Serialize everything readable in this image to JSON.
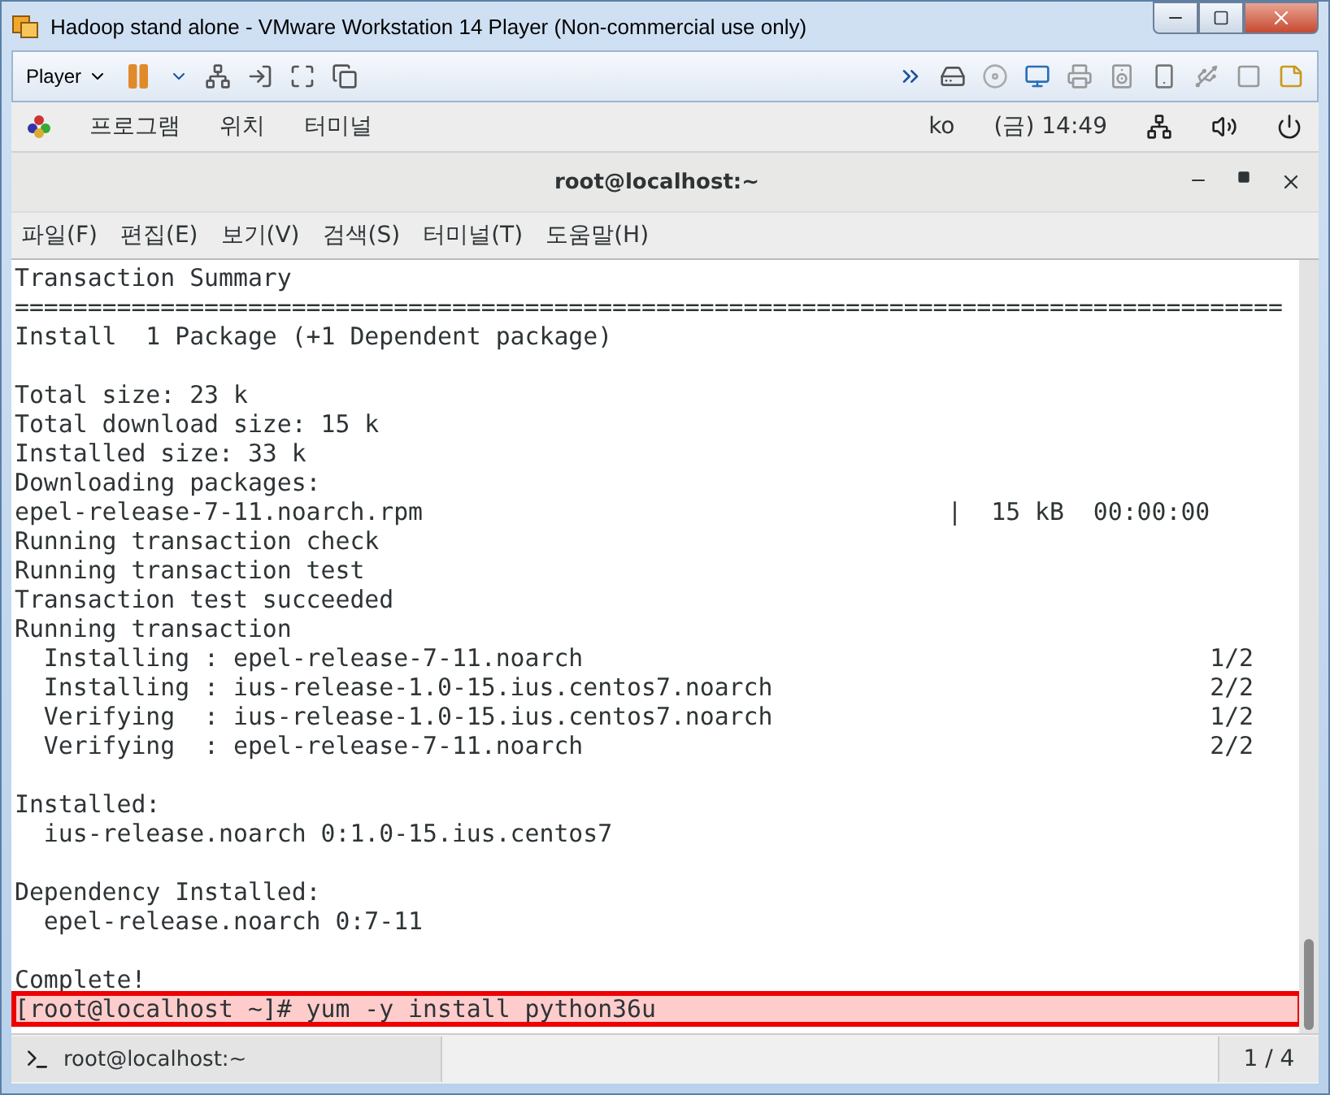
{
  "window": {
    "title": "Hadoop stand alone - VMware Workstation 14 Player (Non-commercial use only)"
  },
  "toolbar": {
    "player_menu": "Player"
  },
  "top_bar": {
    "menus": [
      "프로그램",
      "위치",
      "터미널"
    ],
    "input_method": "ko",
    "clock": "(금) 14:49"
  },
  "terminal": {
    "title": "root@localhost:~",
    "menu": [
      "파일(F)",
      "편집(E)",
      "보기(V)",
      "검색(S)",
      "터미널(T)",
      "도움말(H)"
    ],
    "lines": [
      {
        "kind": "text",
        "text": "Transaction Summary"
      },
      {
        "kind": "text",
        "text": "======================================================================================="
      },
      {
        "kind": "text",
        "text": "Install  1 Package (+1 Dependent package)"
      },
      {
        "kind": "blank"
      },
      {
        "kind": "text",
        "text": "Total size: 23 k"
      },
      {
        "kind": "text",
        "text": "Total download size: 15 k"
      },
      {
        "kind": "text",
        "text": "Installed size: 33 k"
      },
      {
        "kind": "text",
        "text": "Downloading packages:"
      },
      {
        "kind": "text",
        "text": "epel-release-7-11.noarch.rpm                                    |  15 kB  00:00:00"
      },
      {
        "kind": "text",
        "text": "Running transaction check"
      },
      {
        "kind": "text",
        "text": "Running transaction test"
      },
      {
        "kind": "text",
        "text": "Transaction test succeeded"
      },
      {
        "kind": "text",
        "text": "Running transaction"
      },
      {
        "kind": "text",
        "text": "  Installing : epel-release-7-11.noarch                                           1/2"
      },
      {
        "kind": "text",
        "text": "  Installing : ius-release-1.0-15.ius.centos7.noarch                              2/2"
      },
      {
        "kind": "text",
        "text": "  Verifying  : ius-release-1.0-15.ius.centos7.noarch                              1/2"
      },
      {
        "kind": "text",
        "text": "  Verifying  : epel-release-7-11.noarch                                           2/2"
      },
      {
        "kind": "blank"
      },
      {
        "kind": "text",
        "text": "Installed:"
      },
      {
        "kind": "text",
        "text": "  ius-release.noarch 0:1.0-15.ius.centos7"
      },
      {
        "kind": "blank"
      },
      {
        "kind": "text",
        "text": "Dependency Installed:"
      },
      {
        "kind": "text",
        "text": "  epel-release.noarch 0:7-11"
      },
      {
        "kind": "blank"
      },
      {
        "kind": "text",
        "text": "Complete!"
      },
      {
        "kind": "highlight",
        "text": "[root@localhost ~]# yum -y install python36u"
      }
    ]
  },
  "taskbar": {
    "task": "root@localhost:~",
    "workspace": "1 / 4"
  }
}
